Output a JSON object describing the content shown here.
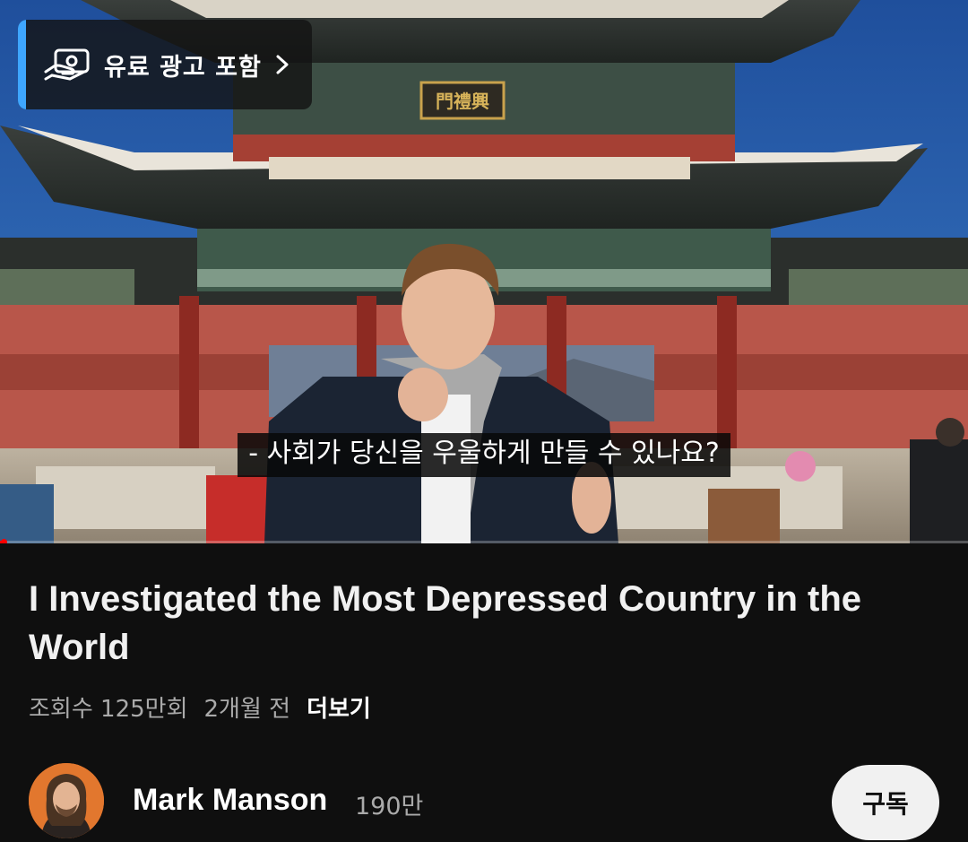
{
  "player": {
    "paid_promotion_label": "유료 광고 포함",
    "paid_promotion_icon": "paid-promotion-icon",
    "chevron_icon": "chevron-right-icon",
    "caption": "- 사회가 당신을 우울하게 만들 수 있나요?",
    "progress_fraction": 0.004,
    "accent_color": "#3ea6ff",
    "progress_color": "#ff0000"
  },
  "video": {
    "title": "I Investigated the Most Depressed Country in the World",
    "views": "조회수 125만회",
    "age": "2개월 전",
    "more_label": "더보기"
  },
  "channel": {
    "name": "Mark Manson",
    "subscribers": "190만",
    "subscribe_label": "구독",
    "avatar_icon": "avatar"
  },
  "scene": {
    "gate_sign": "門禮興"
  }
}
